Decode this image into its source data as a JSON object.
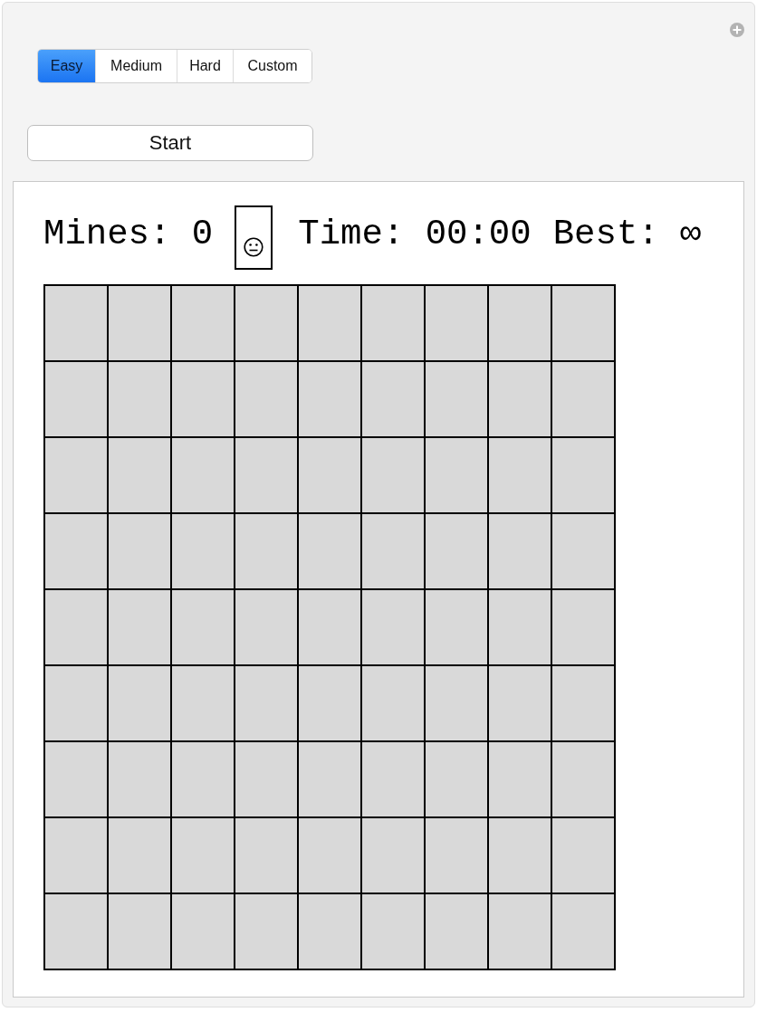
{
  "difficulty_tabs": [
    {
      "label": "Easy",
      "selected": true
    },
    {
      "label": "Medium",
      "selected": false
    },
    {
      "label": "Hard",
      "selected": false
    },
    {
      "label": "Custom",
      "selected": false
    }
  ],
  "start_button": {
    "label": "Start"
  },
  "status": {
    "mines": "Mines: 0",
    "time": "Time: 00:00",
    "best": "Best: ∞"
  },
  "board": {
    "rows": [
      {
        "cells": [
          {
            "revealed": false
          },
          {
            "revealed": false
          },
          {
            "revealed": false
          },
          {
            "revealed": false
          },
          {
            "revealed": false
          },
          {
            "revealed": false
          },
          {
            "revealed": false
          },
          {
            "revealed": false
          },
          {
            "revealed": false
          }
        ]
      },
      {
        "cells": [
          {
            "revealed": false
          },
          {
            "revealed": false
          },
          {
            "revealed": false
          },
          {
            "revealed": false
          },
          {
            "revealed": false
          },
          {
            "revealed": false
          },
          {
            "revealed": false
          },
          {
            "revealed": false
          },
          {
            "revealed": false
          }
        ]
      },
      {
        "cells": [
          {
            "revealed": false
          },
          {
            "revealed": false
          },
          {
            "revealed": false
          },
          {
            "revealed": false
          },
          {
            "revealed": false
          },
          {
            "revealed": false
          },
          {
            "revealed": false
          },
          {
            "revealed": false
          },
          {
            "revealed": false
          }
        ]
      },
      {
        "cells": [
          {
            "revealed": false
          },
          {
            "revealed": false
          },
          {
            "revealed": false
          },
          {
            "revealed": false
          },
          {
            "revealed": false
          },
          {
            "revealed": false
          },
          {
            "revealed": false
          },
          {
            "revealed": false
          },
          {
            "revealed": false
          }
        ]
      },
      {
        "cells": [
          {
            "revealed": false
          },
          {
            "revealed": false
          },
          {
            "revealed": false
          },
          {
            "revealed": false
          },
          {
            "revealed": false
          },
          {
            "revealed": false
          },
          {
            "revealed": false
          },
          {
            "revealed": false
          },
          {
            "revealed": false
          }
        ]
      },
      {
        "cells": [
          {
            "revealed": false
          },
          {
            "revealed": false
          },
          {
            "revealed": false
          },
          {
            "revealed": false
          },
          {
            "revealed": false
          },
          {
            "revealed": false
          },
          {
            "revealed": false
          },
          {
            "revealed": false
          },
          {
            "revealed": false
          }
        ]
      },
      {
        "cells": [
          {
            "revealed": false
          },
          {
            "revealed": false
          },
          {
            "revealed": false
          },
          {
            "revealed": false
          },
          {
            "revealed": false
          },
          {
            "revealed": false
          },
          {
            "revealed": false
          },
          {
            "revealed": false
          },
          {
            "revealed": false
          }
        ]
      },
      {
        "cells": [
          {
            "revealed": false
          },
          {
            "revealed": false
          },
          {
            "revealed": false
          },
          {
            "revealed": false
          },
          {
            "revealed": false
          },
          {
            "revealed": false
          },
          {
            "revealed": false
          },
          {
            "revealed": false
          },
          {
            "revealed": false
          }
        ]
      },
      {
        "cells": [
          {
            "revealed": false
          },
          {
            "revealed": false
          },
          {
            "revealed": false
          },
          {
            "revealed": false
          },
          {
            "revealed": false
          },
          {
            "revealed": false
          },
          {
            "revealed": false
          },
          {
            "revealed": false
          },
          {
            "revealed": false
          }
        ]
      }
    ]
  }
}
